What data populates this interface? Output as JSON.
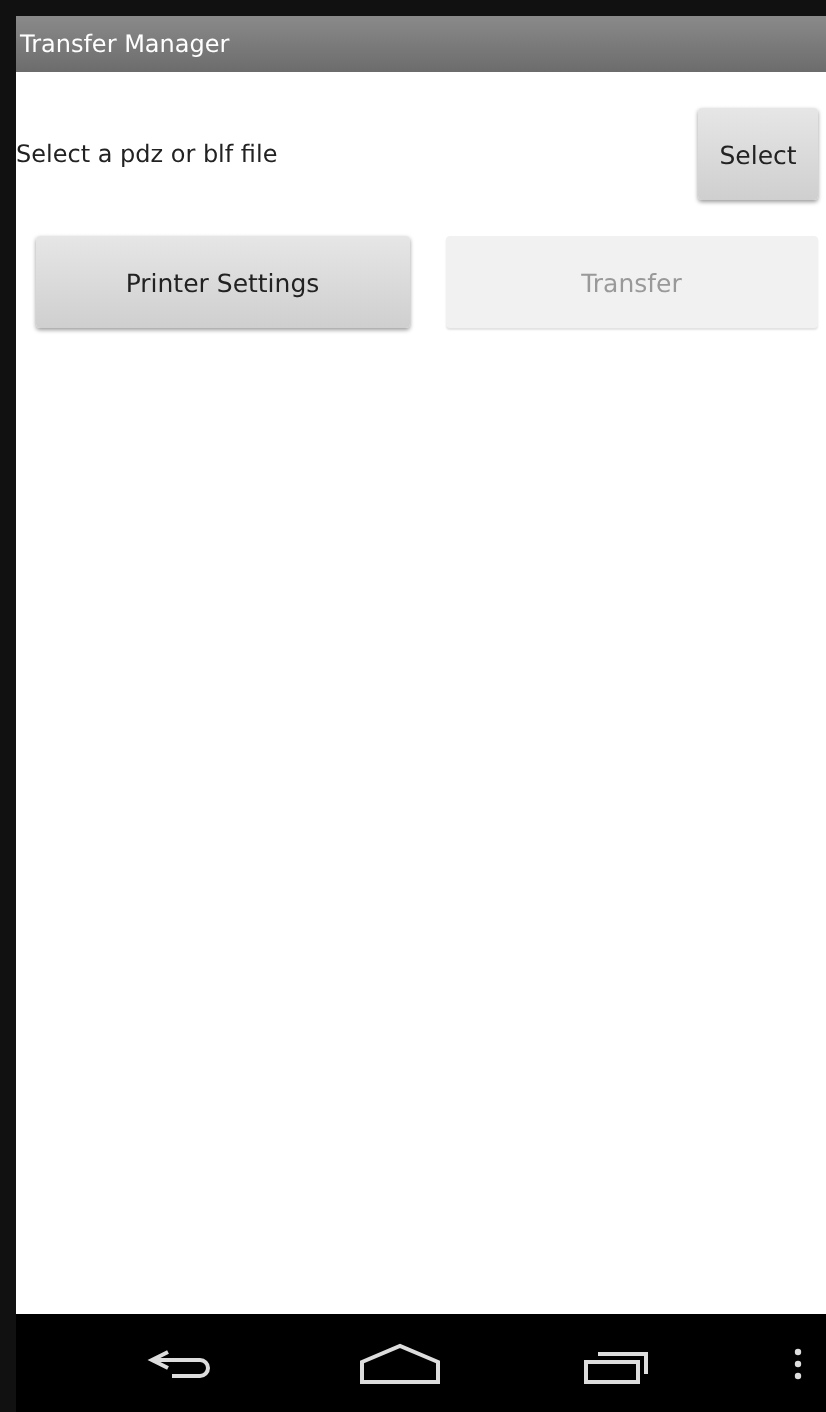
{
  "window": {
    "title": "Transfer Manager"
  },
  "file_prompt": {
    "label": "Select a pdz or blf file",
    "button": "Select"
  },
  "buttons": [
    {
      "label": "Printer Settings",
      "disabled": false
    },
    {
      "label": "Transfer",
      "disabled": true
    }
  ],
  "nav_bar": {
    "keys": [
      {
        "kind": "back"
      },
      {
        "kind": "home"
      },
      {
        "kind": "recents"
      },
      {
        "kind": "menu"
      }
    ]
  }
}
